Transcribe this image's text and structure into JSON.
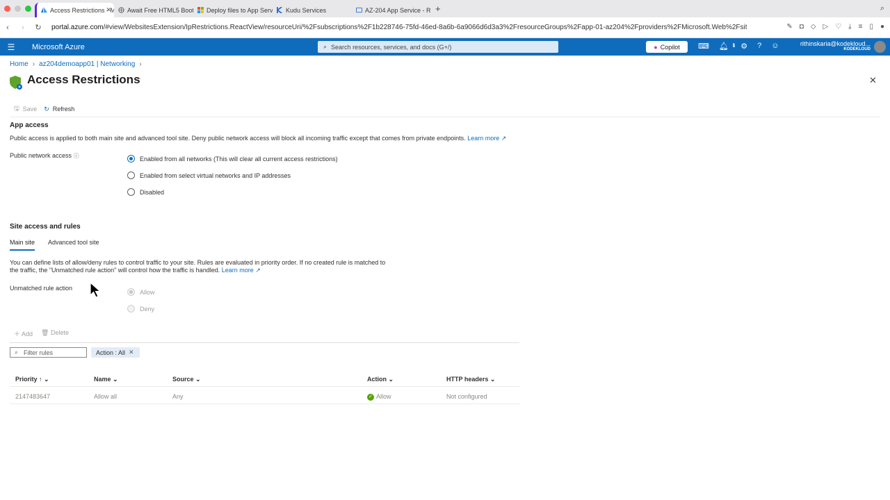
{
  "browser": {
    "tabs": [
      {
        "label": "Access Restrictions - M",
        "active": true,
        "icon": "azure-icon"
      },
      {
        "label": "Await Free HTML5 Boots",
        "active": false,
        "icon": "globe-icon"
      },
      {
        "label": "Deploy files to App Serv",
        "active": false,
        "icon": "microsoft-icon"
      },
      {
        "label": "Kudu Services",
        "active": false,
        "icon": "kudu-icon"
      },
      {
        "label": "AZ-204 App Service - R",
        "active": false,
        "icon": "app-icon"
      }
    ],
    "url_domain": "portal.azure.com",
    "url_rest": "/#view/WebsitesExtension/IpRestrictions.ReactView/resourceUri/%2Fsubscriptions%2F1b228746-75fd-46ed-8a6b-6a9066d6d3a3%2FresourceGroups%2Fapp-01-az204%2Fproviders%2FMicrosoft.Web%2Fsite"
  },
  "azure": {
    "brand": "Microsoft Azure",
    "search_placeholder": "Search resources, services, and docs (G+/)",
    "copilot": "Copilot",
    "notification_count": "3",
    "user_email": "rithinskaria@kodekloud...",
    "user_org": "KODEKLOUD"
  },
  "breadcrumb": {
    "home": "Home",
    "parent": "az204demoapp01 | Networking"
  },
  "page": {
    "title": "Access Restrictions",
    "more": "···",
    "save": "Save",
    "refresh": "Refresh"
  },
  "app_access": {
    "title": "App access",
    "description": "Public access is applied to both main site and advanced tool site. Deny public network access will block all incoming traffic except that comes from private endpoints.",
    "learn_more": "Learn more",
    "public_label": "Public network access",
    "options": [
      {
        "label": "Enabled from all networks (This will clear all current access restrictions)",
        "selected": true
      },
      {
        "label": "Enabled from select virtual networks and IP addresses",
        "selected": false
      },
      {
        "label": "Disabled",
        "selected": false
      }
    ]
  },
  "site_access": {
    "title": "Site access and rules",
    "tabs": [
      "Main site",
      "Advanced tool site"
    ],
    "description_1": "You can define lists of allow/deny rules to control traffic to your site. Rules are evaluated in priority order. If no created rule is matched to",
    "description_2": "the traffic, the \"Unmatched rule action\" will control how the traffic is handled.",
    "learn_more": "Learn more",
    "unmatched_label": "Unmatched rule action",
    "unmatched_options": [
      {
        "label": "Allow",
        "selected": true
      },
      {
        "label": "Deny",
        "selected": false
      }
    ],
    "add": "Add",
    "delete": "Delete",
    "filter_placeholder": "Filter rules",
    "filter_pill": "Action : All",
    "columns": [
      "Priority ↑",
      "Name",
      "Source",
      "Action",
      "HTTP headers"
    ],
    "rows": [
      {
        "priority": "2147483647",
        "name": "Allow all",
        "source": "Any",
        "action": "Allow",
        "headers": "Not configured"
      }
    ]
  }
}
